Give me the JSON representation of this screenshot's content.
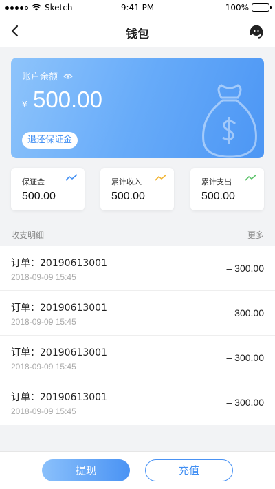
{
  "status_bar": {
    "carrier": "Sketch",
    "time": "9:41 PM",
    "battery": "100%",
    "battery_level": 1.0
  },
  "nav": {
    "title": "钱包",
    "back_icon": "chevron-left-icon",
    "support_icon": "headset-icon"
  },
  "balance_card": {
    "label": "账户余额",
    "currency": "¥",
    "amount": "500.00",
    "refund_button": "退还保证金",
    "eye_icon": "eye-icon",
    "decor_icon": "money-bag-icon"
  },
  "stats": [
    {
      "label": "保证金",
      "value": "500.00",
      "icon": "trend-line-icon",
      "color": "#3f8ef3"
    },
    {
      "label": "累计收入",
      "value": "500.00",
      "icon": "trend-line-icon",
      "color": "#f2b534"
    },
    {
      "label": "累计支出",
      "value": "500.00",
      "icon": "trend-line-icon",
      "color": "#5cc36a"
    }
  ],
  "section": {
    "title": "收支明细",
    "more": "更多"
  },
  "transactions": [
    {
      "order": "订单：20190613001",
      "time": "2018-09-09 15:45",
      "amount": "– 300.00"
    },
    {
      "order": "订单：20190613001",
      "time": "2018-09-09 15:45",
      "amount": "– 300.00"
    },
    {
      "order": "订单：20190613001",
      "time": "2018-09-09 15:45",
      "amount": "– 300.00"
    },
    {
      "order": "订单：20190613001",
      "time": "2018-09-09 15:45",
      "amount": "– 300.00"
    }
  ],
  "actions": {
    "withdraw": "提现",
    "recharge": "充值"
  },
  "colors": {
    "accent": "#3f8ef3",
    "card_gradient_start": "#8ec4fb",
    "card_gradient_end": "#4c96f4"
  }
}
